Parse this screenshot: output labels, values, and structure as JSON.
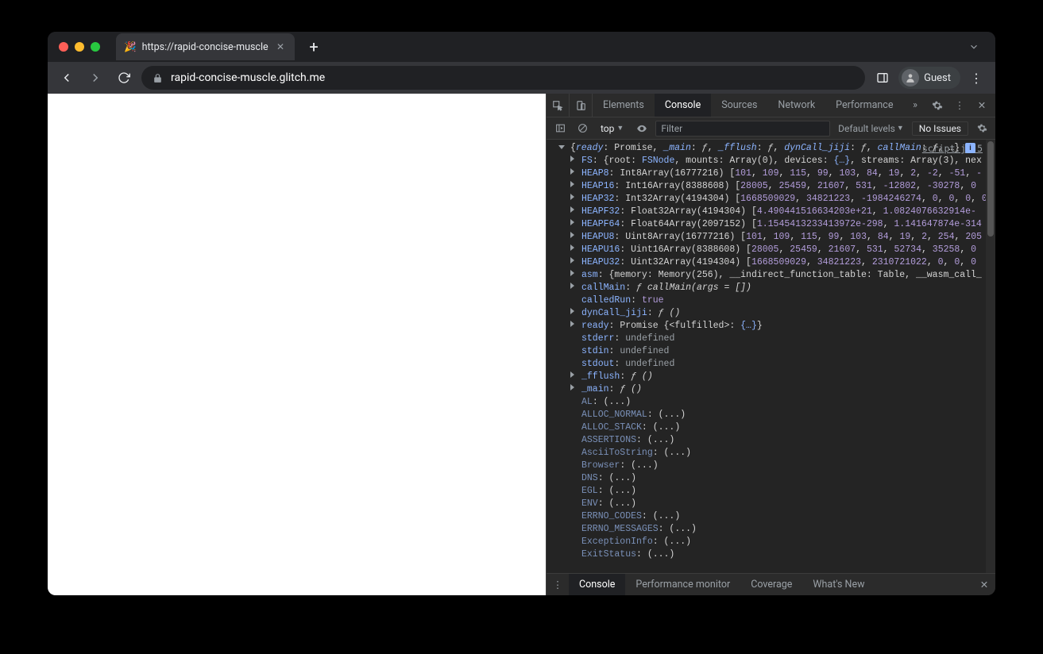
{
  "browser": {
    "tab_title": "https://rapid-concise-muscle.g",
    "url_host": "rapid-concise-muscle.glitch.me",
    "guest_label": "Guest"
  },
  "devtools": {
    "tabs": [
      "Elements",
      "Console",
      "Sources",
      "Network",
      "Performance"
    ],
    "active_tab": "Console",
    "context": "top",
    "filter_placeholder": "Filter",
    "levels_label": "Default levels",
    "issues_label": "No Issues",
    "source_link": "script.js:5",
    "drawer_tabs": [
      "Console",
      "Performance monitor",
      "Coverage",
      "What's New"
    ],
    "drawer_active": "Console"
  },
  "console": {
    "top_line": {
      "segments": [
        {
          "k": "ready",
          "after": ": Promise, "
        },
        {
          "k": "_main",
          "after": ": ",
          "fval": "ƒ",
          "post": ", "
        },
        {
          "k": "_fflush",
          "after": ": ",
          "fval": "ƒ",
          "post": ", "
        },
        {
          "k": "dynCall_jiji",
          "after": ": ",
          "fval": "ƒ",
          "post": ", "
        },
        {
          "k": "callMain",
          "after": ": ",
          "fval": "ƒ",
          "post": ", …} "
        }
      ]
    },
    "rows": [
      {
        "tw": true,
        "key": "FS",
        "rest": ": {root: ",
        "k2": "FSNode",
        "r2": ", mounts: Array(0), devices: ",
        "k3": "{…}",
        "r3": ", streams: Array(3), nex"
      },
      {
        "tw": true,
        "key": "HEAP8",
        "type": ": Int8Array(16777216) [",
        "nums": [
          "101",
          "109",
          "115",
          "99",
          "103",
          "84",
          "19",
          "2",
          "-2",
          "-51",
          "-"
        ]
      },
      {
        "tw": true,
        "key": "HEAP16",
        "type": ": Int16Array(8388608) [",
        "nums": [
          "28005",
          "25459",
          "21607",
          "531",
          "-12802",
          "-30278",
          "0"
        ]
      },
      {
        "tw": true,
        "key": "HEAP32",
        "type": ": Int32Array(4194304) [",
        "nums": [
          "1668509029",
          "34821223",
          "-1984246274",
          "0",
          "0",
          "0",
          "0"
        ]
      },
      {
        "tw": true,
        "key": "HEAPF32",
        "type": ": Float32Array(4194304) [",
        "nums": [
          "4.490441516634203e+21",
          "1.0824076632914e-"
        ]
      },
      {
        "tw": true,
        "key": "HEAPF64",
        "type": ": Float64Array(2097152) [",
        "nums": [
          "1.1545413233413972e-298",
          "1.141647874e-314"
        ]
      },
      {
        "tw": true,
        "key": "HEAPU8",
        "type": ": Uint8Array(16777216) [",
        "nums": [
          "101",
          "109",
          "115",
          "99",
          "103",
          "84",
          "19",
          "2",
          "254",
          "205"
        ]
      },
      {
        "tw": true,
        "key": "HEAPU16",
        "type": ": Uint16Array(8388608) [",
        "nums": [
          "28005",
          "25459",
          "21607",
          "531",
          "52734",
          "35258",
          "0"
        ]
      },
      {
        "tw": true,
        "key": "HEAPU32",
        "type": ": Uint32Array(4194304) [",
        "nums": [
          "1668509029",
          "34821223",
          "2310721022",
          "0",
          "0",
          "0"
        ]
      },
      {
        "tw": true,
        "key": "asm",
        "rest": ": {memory: Memory(256), __indirect_function_table: Table, __wasm_call_"
      },
      {
        "tw": true,
        "key": "callMain",
        "rest": ": ",
        "fval": "ƒ callMain(args = [])"
      },
      {
        "key": "calledRun",
        "rest": ": ",
        "bool": "true"
      },
      {
        "tw": true,
        "key": "dynCall_jiji",
        "rest": ": ",
        "fval": "ƒ ()"
      },
      {
        "tw": true,
        "key": "ready",
        "rest": ": Promise {<fulfilled>: ",
        "k2": "{…}",
        "r2": "}"
      },
      {
        "key": "stderr",
        "rest": ": ",
        "undef": "undefined"
      },
      {
        "key": "stdin",
        "rest": ": ",
        "undef": "undefined"
      },
      {
        "key": "stdout",
        "rest": ": ",
        "undef": "undefined"
      },
      {
        "tw": true,
        "key": "_fflush",
        "rest": ": ",
        "fval": "ƒ ()"
      },
      {
        "tw": true,
        "key": "_main",
        "rest": ": ",
        "fval": "ƒ ()"
      },
      {
        "faded": true,
        "key": "AL",
        "rest": ": (...)"
      },
      {
        "faded": true,
        "key": "ALLOC_NORMAL",
        "rest": ": (...)"
      },
      {
        "faded": true,
        "key": "ALLOC_STACK",
        "rest": ": (...)"
      },
      {
        "faded": true,
        "key": "ASSERTIONS",
        "rest": ": (...)"
      },
      {
        "faded": true,
        "key": "AsciiToString",
        "rest": ": (...)"
      },
      {
        "faded": true,
        "key": "Browser",
        "rest": ": (...)"
      },
      {
        "faded": true,
        "key": "DNS",
        "rest": ": (...)"
      },
      {
        "faded": true,
        "key": "EGL",
        "rest": ": (...)"
      },
      {
        "faded": true,
        "key": "ENV",
        "rest": ": (...)"
      },
      {
        "faded": true,
        "key": "ERRNO_CODES",
        "rest": ": (...)"
      },
      {
        "faded": true,
        "key": "ERRNO_MESSAGES",
        "rest": ": (...)"
      },
      {
        "faded": true,
        "key": "ExceptionInfo",
        "rest": ": (...)"
      },
      {
        "faded": true,
        "key": "ExitStatus",
        "rest": ": (...)"
      }
    ]
  }
}
